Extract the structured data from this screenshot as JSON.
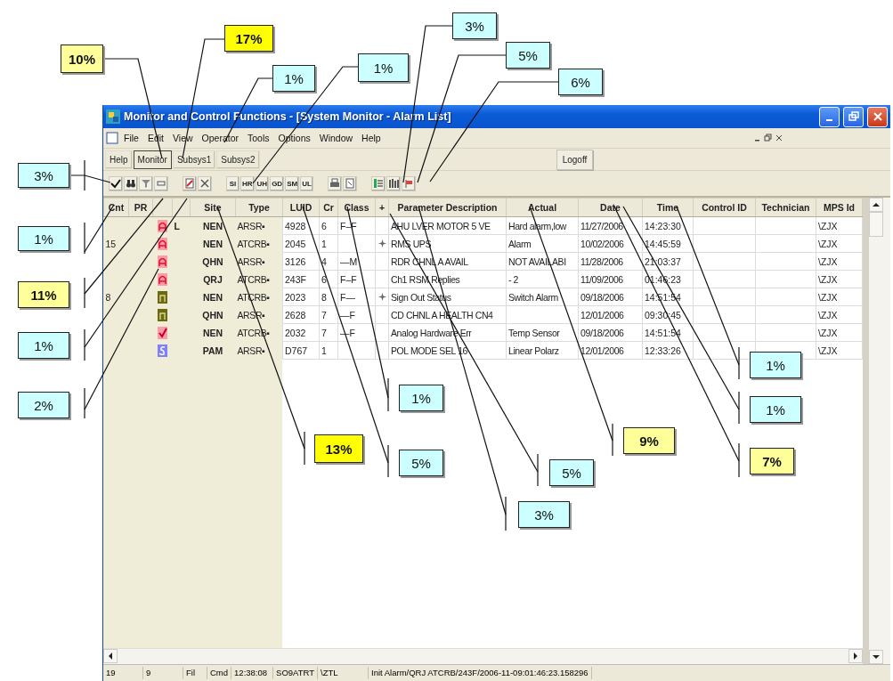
{
  "window": {
    "title": "Monitor and Control Functions - [System Monitor - Alarm List]"
  },
  "menu": [
    "File",
    "Edit",
    "View",
    "Operator",
    "Tools",
    "Options",
    "Window",
    "Help"
  ],
  "tabs": [
    {
      "label": "Help",
      "selected": false
    },
    {
      "label": "Monitor",
      "selected": true
    },
    {
      "label": "Subsys1",
      "selected": false
    },
    {
      "label": "Subsys2",
      "selected": false
    }
  ],
  "logoff_button": "Logoff",
  "toolbar": [
    {
      "kind": "check"
    },
    {
      "kind": "binoculars"
    },
    {
      "kind": "filter"
    },
    {
      "kind": "small"
    },
    {
      "kind": "gap"
    },
    {
      "kind": "note"
    },
    {
      "kind": "tools"
    },
    {
      "kind": "gap"
    },
    {
      "kind": "text",
      "label": "SI"
    },
    {
      "kind": "text",
      "label": "HR"
    },
    {
      "kind": "text",
      "label": "UH"
    },
    {
      "kind": "text",
      "label": "GD"
    },
    {
      "kind": "text",
      "label": "SM"
    },
    {
      "kind": "text",
      "label": "UL"
    },
    {
      "kind": "gap"
    },
    {
      "kind": "printer"
    },
    {
      "kind": "page"
    },
    {
      "kind": "gap"
    },
    {
      "kind": "list"
    },
    {
      "kind": "bars"
    },
    {
      "kind": "flag"
    }
  ],
  "table": {
    "columns": [
      "Cnt",
      "PR",
      "Site",
      "Type",
      "LUID",
      "Cr",
      "Class",
      "+",
      "Parameter Description",
      "Actual",
      "Date",
      "Time",
      "Control ID",
      "Technician",
      "MPS Id"
    ],
    "rows": [
      {
        "kind": "alarm",
        "mark": "L",
        "site": "NEN",
        "type": "ARSR▪",
        "luid": "4928",
        "cr": "6",
        "class": "F–F",
        "flag": false,
        "description": "AHU LVER MOTOR 5 VE",
        "actual": "Hard alarm,low",
        "date": "11/27/2006",
        "time": "14:23:30",
        "mps_id": "\\ZJX"
      },
      {
        "cnt": "15",
        "kind": "alarm",
        "site": "NEN",
        "type": "ATCRB▪",
        "luid": "2045",
        "cr": "1",
        "flag": true,
        "description": "RMS UPS",
        "actual": "Alarm",
        "date": "10/02/2006",
        "time": "14:45:59",
        "mps_id": "\\ZJX"
      },
      {
        "kind": "alarm",
        "site": "QHN",
        "type": "ARSR▪",
        "luid": "3126",
        "cr": "4",
        "class": "—M",
        "flag": false,
        "description": "RDR CHNL A AVAIL",
        "actual": "NOT AVAILABI",
        "date": "11/28/2006",
        "time": "21:03:37",
        "mps_id": "\\ZJX"
      },
      {
        "kind": "alarm",
        "site": "QRJ",
        "type": "ATCRB▪",
        "luid": "243F",
        "cr": "6",
        "class": "F–F",
        "flag": false,
        "description": "Ch1 RSM Replies",
        "actual": "-   2",
        "date": "11/09/2006",
        "time": "01:46:23",
        "mps_id": "\\ZJX"
      },
      {
        "cnt": "8",
        "kind": "olive",
        "site": "NEN",
        "type": "ATCRB▪",
        "luid": "2023",
        "cr": "8",
        "class": "F—",
        "flag": true,
        "description": "Sign Out Status",
        "actual": "Switch Alarm",
        "date": "09/18/2006",
        "time": "14:51:54",
        "mps_id": "\\ZJX"
      },
      {
        "kind": "olive",
        "site": "QHN",
        "type": "ARSR▪",
        "luid": "2628",
        "cr": "7",
        "class": "—F",
        "flag": false,
        "description": "CD CHNL A HEALTH CN4",
        "date": "12/01/2006",
        "time": "09:30:45",
        "mps_id": "\\ZJX"
      },
      {
        "kind": "check",
        "site": "NEN",
        "type": "ATCRB▪",
        "luid": "2032",
        "cr": "7",
        "class": "—F",
        "flag": false,
        "description": "Analog Hardware Err",
        "actual": "Temp Sensor",
        "date": "09/18/2006",
        "time": "14:51:54",
        "mps_id": "\\ZJX"
      },
      {
        "kind": "service",
        "site": "PAM",
        "type": "ARSR▪",
        "luid": "D767",
        "cr": "1",
        "flag": false,
        "description": "POL MODE SEL 16",
        "actual": "Linear Polarz",
        "date": "12/01/2006",
        "time": "12:33:26",
        "mps_id": "\\ZJX"
      }
    ]
  },
  "status_bar": [
    "19",
    "9",
    "Fil",
    "Cmd",
    "12:38:08",
    "SO9ATRT",
    "\\ZTL",
    "Init Alarm/QRJ  ATCRB/243F/2006-11-09:01:46:23.158296"
  ],
  "callouts": [
    {
      "label": "3%",
      "color": "#ccffff",
      "emphasis": false
    },
    {
      "label": "17%",
      "color": "#ffff00",
      "emphasis": true
    },
    {
      "label": "5%",
      "color": "#ccffff",
      "emphasis": false
    },
    {
      "label": "10%",
      "color": "#ffff99",
      "emphasis": true
    },
    {
      "label": "1%",
      "color": "#ccffff",
      "emphasis": false
    },
    {
      "label": "1%",
      "color": "#ccffff",
      "emphasis": false
    },
    {
      "label": "6%",
      "color": "#ccffff",
      "emphasis": false
    },
    {
      "label": "3%",
      "color": "#ccffff",
      "emphasis": false
    },
    {
      "label": "1%",
      "color": "#ccffff",
      "emphasis": false
    },
    {
      "label": "11%",
      "color": "#ffff99",
      "emphasis": true
    },
    {
      "label": "1%",
      "color": "#ccffff",
      "emphasis": false
    },
    {
      "label": "1%",
      "color": "#ccffff",
      "emphasis": false
    },
    {
      "label": "1%",
      "color": "#ccffff",
      "emphasis": false
    },
    {
      "label": "2%",
      "color": "#ccffff",
      "emphasis": false
    },
    {
      "label": "1%",
      "color": "#ccffff",
      "emphasis": false
    },
    {
      "label": "9%",
      "color": "#ffff99",
      "emphasis": true
    },
    {
      "label": "13%",
      "color": "#ffff00",
      "emphasis": true
    },
    {
      "label": "7%",
      "color": "#ffff99",
      "emphasis": true
    },
    {
      "label": "5%",
      "color": "#ccffff",
      "emphasis": false
    },
    {
      "label": "5%",
      "color": "#ccffff",
      "emphasis": false
    },
    {
      "label": "3%",
      "color": "#ccffff",
      "emphasis": false
    }
  ]
}
